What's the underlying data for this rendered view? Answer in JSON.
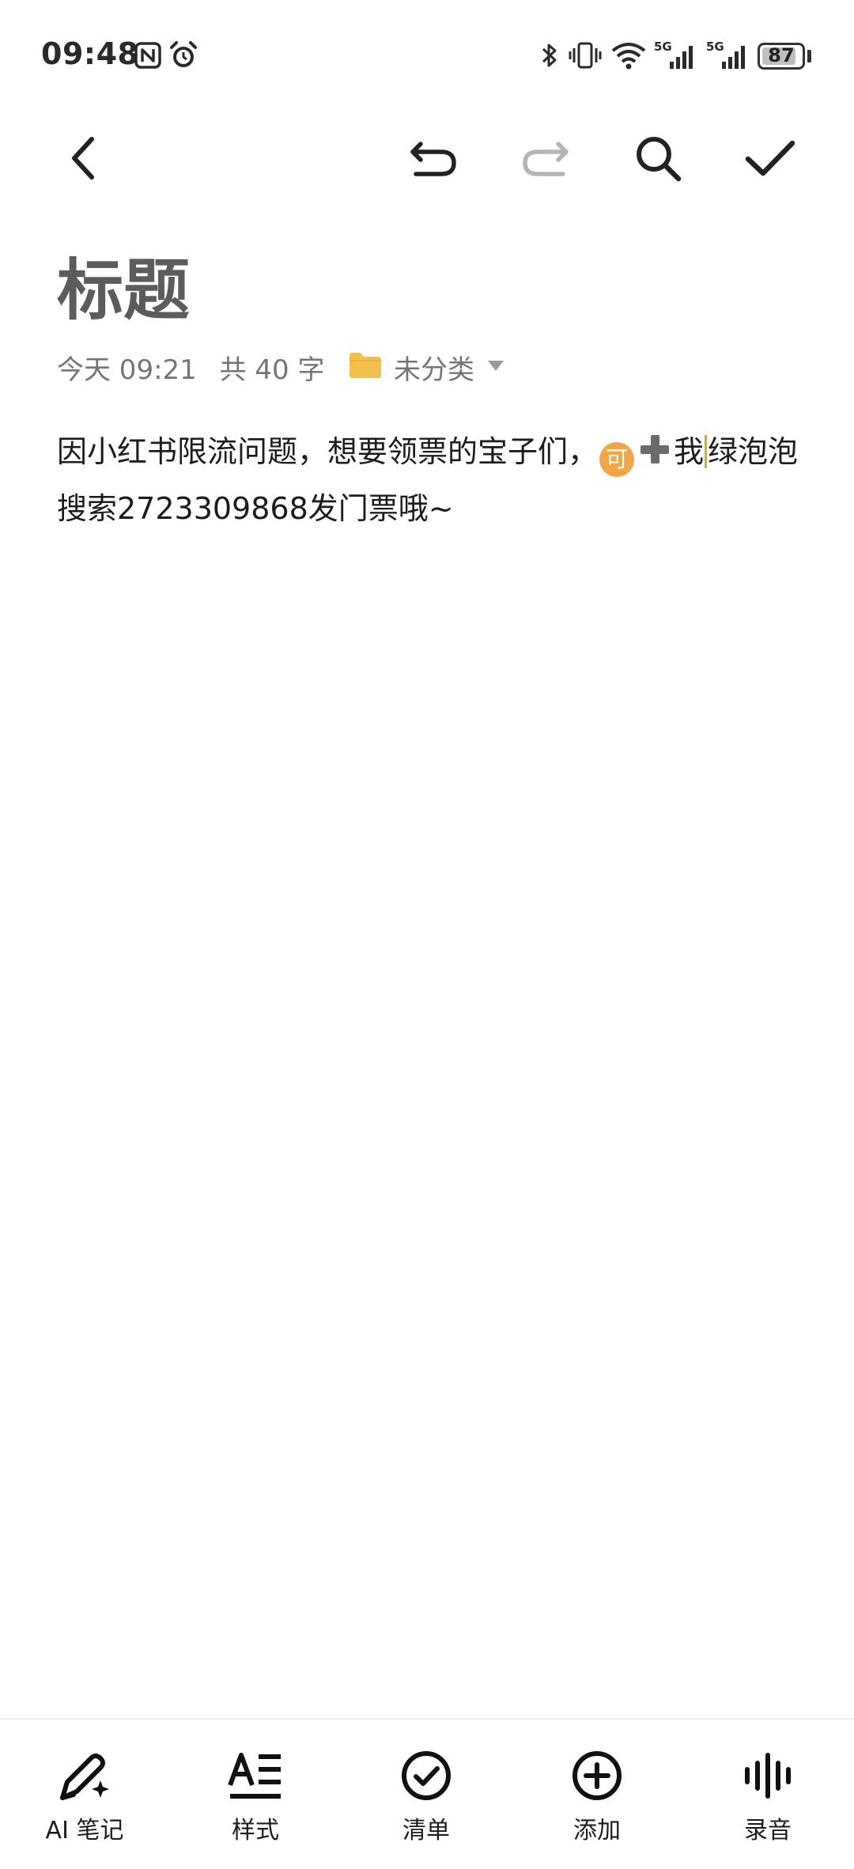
{
  "status_bar": {
    "time": "09:48",
    "battery": "87",
    "battery_level": 0.87,
    "network_1": "5G",
    "network_2": "5G"
  },
  "toolbar": {
    "back": "back-icon",
    "undo": "undo-icon",
    "redo": "redo-icon",
    "search": "search-icon",
    "confirm": "check-icon"
  },
  "note": {
    "title": "标题",
    "date": "今天 09:21",
    "word_count": "共 40 字",
    "category": "未分类",
    "body_part1": "因小红书限流问题，想要领票的宝子们，",
    "emoji_ke": "可",
    "body_part2": "我",
    "body_part3": "绿泡泡搜索2723309868发门票哦~"
  },
  "bottom_bar": {
    "items": [
      {
        "label": "AI 笔记",
        "icon": "ai-pen-icon"
      },
      {
        "label": "样式",
        "icon": "text-style-icon"
      },
      {
        "label": "清单",
        "icon": "checklist-icon"
      },
      {
        "label": "添加",
        "icon": "add-icon"
      },
      {
        "label": "录音",
        "icon": "voice-icon"
      }
    ]
  },
  "colors": {
    "accent": "#f0a646",
    "folder": "#f2c04a",
    "redo_disabled": "#b5b5b5"
  }
}
